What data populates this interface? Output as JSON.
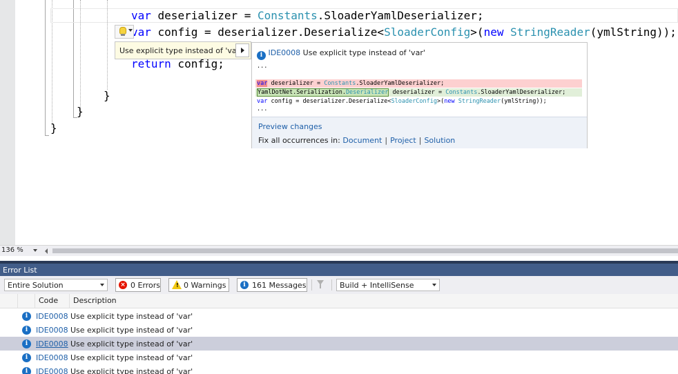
{
  "editor": {
    "lines": {
      "l1": {
        "kw": "var",
        "rest1": " deserializer = ",
        "type1": "Constants",
        "rest2": ".SloaderYamlDeserializer;"
      },
      "l2": {
        "kw": "var",
        "rest1": " config = deserializer.Deserialize<",
        "type1": "SloaderConfig",
        "rest2": ">(",
        "kw2": "new",
        "sp": " ",
        "type2": "StringReader",
        "rest3": "(ymlString));"
      },
      "l3": {
        "kw": "return",
        "rest1": " config;"
      },
      "l4": "}",
      "l5": "}",
      "l6": "}"
    }
  },
  "quick_actions": {
    "icon": "lightbulb-icon",
    "suggestion": "Use explicit type instead of 'var'",
    "preview": {
      "code": "IDE0008",
      "title": "Use explicit type instead of 'var'",
      "ellipsis_top": "...",
      "removed": {
        "kw": "var",
        "rest1": " deserializer = ",
        "type1": "Constants",
        "rest2": ".SloaderYamlDeserializer;"
      },
      "added": {
        "ns": "YamlDotNet.Serialization.",
        "type0": "Deserializer",
        "rest1": " deserializer = ",
        "type1": "Constants",
        "rest2": ".SloaderYamlDeserializer;"
      },
      "context": {
        "kw": "var",
        "rest1": " config = deserializer.Deserialize<",
        "type1": "SloaderConfig",
        "rest2": ">(",
        "kw2": "new",
        "sp": " ",
        "type2": "StringReader",
        "rest3": "(ymlString));"
      },
      "ellipsis_bottom": "...",
      "preview_changes": "Preview changes",
      "fix_all_label": "Fix all occurrences in:",
      "fix_document": "Document",
      "fix_project": "Project",
      "fix_solution": "Solution",
      "separator": "|"
    }
  },
  "zoom": {
    "level": "136 %"
  },
  "error_list": {
    "title": "Error List",
    "scope": "Entire Solution",
    "errors": "0 Errors",
    "warnings": "0 Warnings",
    "messages": "161 Messages",
    "source": "Build + IntelliSense",
    "columns": {
      "code": "Code",
      "description": "Description"
    },
    "rows": [
      {
        "code": "IDE0008",
        "description": "Use explicit type instead of 'var'"
      },
      {
        "code": "IDE0008",
        "description": "Use explicit type instead of 'var'"
      },
      {
        "code": "IDE0008",
        "description": "Use explicit type instead of 'var'"
      },
      {
        "code": "IDE0008",
        "description": "Use explicit type instead of 'var'"
      },
      {
        "code": "IDE0008",
        "description": "Use explicit type instead of 'var'"
      }
    ]
  },
  "colors": {
    "keyword": "#0000ff",
    "type": "#2b91af",
    "titlebar": "#425d89",
    "info": "#1a6fc4"
  }
}
